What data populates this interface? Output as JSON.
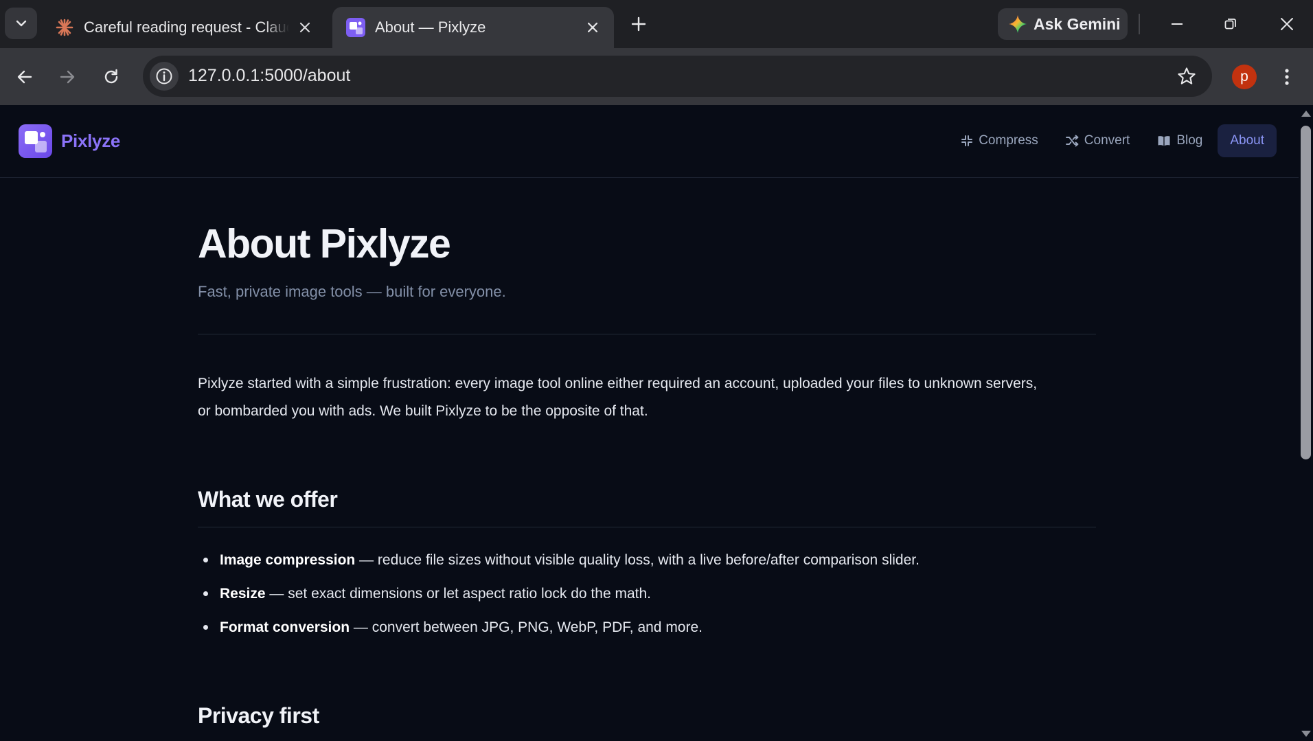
{
  "browser": {
    "tabs": [
      {
        "title": "Careful reading request - Claude",
        "favicon": "claude-sparkle-icon",
        "active": false
      },
      {
        "title": "About — Pixlyze",
        "favicon": "pixlyze-logo-icon",
        "active": true
      }
    ],
    "gemini_label": "Ask Gemini",
    "url": "127.0.0.1:5000/about",
    "profile_initial": "p",
    "colors": {
      "strip": "#1f2024",
      "toolbar": "#36373c",
      "omnibox": "#232428",
      "avatar": "#c2320f"
    }
  },
  "site": {
    "brand": "Pixlyze",
    "nav": [
      {
        "label": "Compress",
        "icon": "compress-icon",
        "active": false
      },
      {
        "label": "Convert",
        "icon": "shuffle-icon",
        "active": false
      },
      {
        "label": "Blog",
        "icon": "book-icon",
        "active": false
      },
      {
        "label": "About",
        "icon": "",
        "active": true
      }
    ],
    "colors": {
      "background": "#080c16",
      "brand": "#8b73f8",
      "nav_active_bg": "#1a2140",
      "nav_active_text": "#8c96f7"
    }
  },
  "page": {
    "title": "About Pixlyze",
    "subtitle": "Fast, private image tools — built for everyone.",
    "intro_line1": "Pixlyze started with a simple frustration: every image tool online either required an account, uploaded your files to unknown servers,",
    "intro_line2": "or bombarded you with ads. We built Pixlyze to be the opposite of that.",
    "offer_heading": "What we offer",
    "offers": [
      {
        "name": "Image compression",
        "desc": " — reduce file sizes without visible quality loss, with a live before/after comparison slider."
      },
      {
        "name": "Resize",
        "desc": " — set exact dimensions or let aspect ratio lock do the math."
      },
      {
        "name": "Format conversion",
        "desc": " — convert between JPG, PNG, WebP, PDF, and more."
      }
    ],
    "privacy_heading": "Privacy first"
  }
}
